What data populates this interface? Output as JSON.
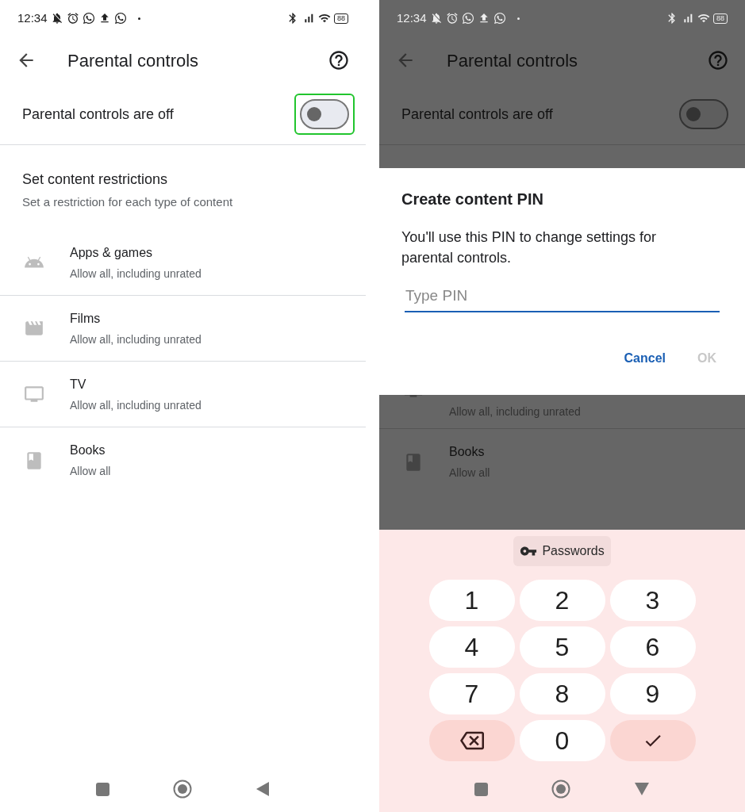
{
  "screens": [
    {
      "dimmed": false,
      "status_bar": {
        "time": "12:34",
        "battery": "88"
      },
      "header": {
        "title": "Parental controls"
      },
      "toggle": {
        "label": "Parental controls are off",
        "on": false,
        "highlighted": true
      },
      "section": {
        "title": "Set content restrictions",
        "subtitle": "Set a restriction for each type of content"
      },
      "rows": [
        {
          "kind": "android",
          "title": "Apps & games",
          "subtitle": "Allow all, including unrated"
        },
        {
          "kind": "film",
          "title": "Films",
          "subtitle": "Allow all, including unrated"
        },
        {
          "kind": "tv",
          "title": "TV",
          "subtitle": "Allow all, including unrated"
        },
        {
          "kind": "book",
          "title": "Books",
          "subtitle": "Allow all"
        }
      ],
      "nav": {
        "keyboard_open": false
      }
    },
    {
      "dimmed": true,
      "status_bar": {
        "time": "12:34",
        "battery": "88"
      },
      "header": {
        "title": "Parental controls"
      },
      "toggle": {
        "label": "Parental controls are off",
        "on": false,
        "highlighted": false
      },
      "dialog": {
        "title": "Create content PIN",
        "body": "You'll use this PIN to change settings for parental controls.",
        "input": {
          "placeholder": "Type PIN"
        },
        "buttons": [
          {
            "label": "Cancel",
            "disabled": false
          },
          {
            "label": "OK",
            "disabled": true
          }
        ]
      },
      "partial_rows": [
        {
          "kind": "tv",
          "subtitle": "Allow all, including unrated"
        },
        {
          "kind": "book",
          "title": "Books",
          "subtitle": "Allow all"
        }
      ],
      "keyboard": {
        "suggestion": "Passwords",
        "keys": [
          {
            "kind": "digit",
            "label": "1"
          },
          {
            "kind": "digit",
            "label": "2"
          },
          {
            "kind": "digit",
            "label": "3"
          },
          {
            "kind": "digit",
            "label": "4"
          },
          {
            "kind": "digit",
            "label": "5"
          },
          {
            "kind": "digit",
            "label": "6"
          },
          {
            "kind": "digit",
            "label": "7"
          },
          {
            "kind": "digit",
            "label": "8"
          },
          {
            "kind": "digit",
            "label": "9"
          },
          {
            "kind": "backspace"
          },
          {
            "kind": "digit",
            "label": "0"
          },
          {
            "kind": "done"
          }
        ]
      },
      "nav": {
        "keyboard_open": true
      }
    }
  ]
}
